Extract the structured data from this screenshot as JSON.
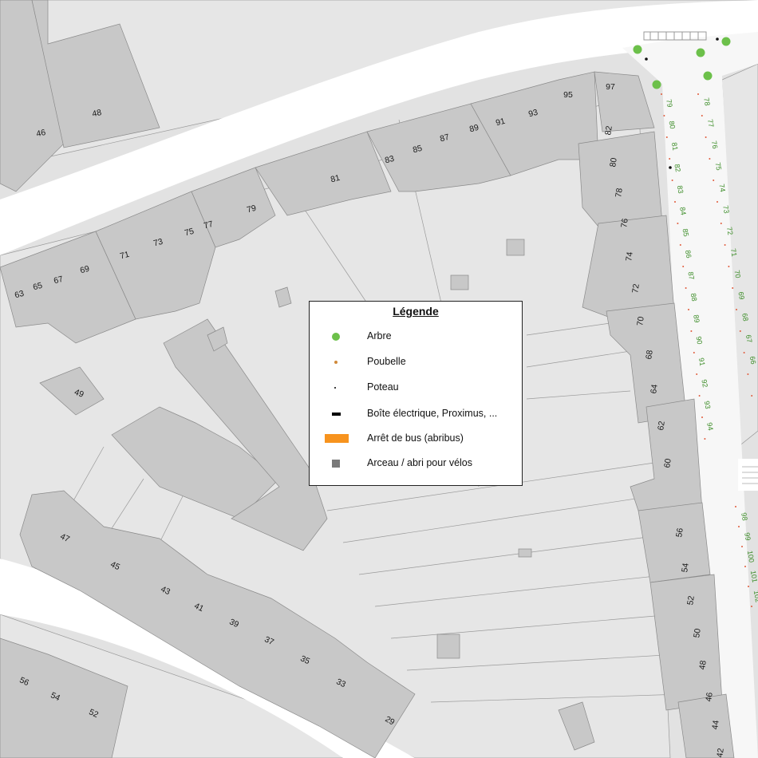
{
  "colors": {
    "background": "#e0e0e0",
    "road": "#ffffff",
    "parcel": "#e6e6e6",
    "building": "#c8c8c8",
    "tree": "#6cc04a",
    "bin": "#d08a3a",
    "bus_stop": "#f7931e",
    "bike": "#7a7a7a",
    "parking_label": "#3e8e2a"
  },
  "legend": {
    "title": "Légende",
    "items": [
      {
        "key": "tree",
        "label": "Arbre",
        "icon": "green-dot"
      },
      {
        "key": "bin",
        "label": "Poubelle",
        "icon": "orange-dot"
      },
      {
        "key": "pole",
        "label": "Poteau",
        "icon": "black-dot"
      },
      {
        "key": "box",
        "label": "Boîte électrique, Proximus, ...",
        "icon": "black-bar"
      },
      {
        "key": "bus",
        "label": "Arrêt de bus (abribus)",
        "icon": "orange-rectangle"
      },
      {
        "key": "bike",
        "label": "Arceau / abri pour vélos",
        "icon": "grey-square"
      }
    ]
  },
  "house_numbers": {
    "upper_street": [
      "46",
      "48",
      "63",
      "65",
      "67",
      "69",
      "71",
      "73",
      "75",
      "77",
      "79",
      "81",
      "83",
      "85",
      "87",
      "89",
      "91",
      "93",
      "95",
      "97"
    ],
    "inner_block": [
      "49"
    ],
    "east_street": [
      "82",
      "80",
      "78",
      "76",
      "74",
      "72",
      "70",
      "68",
      "64",
      "62",
      "60",
      "56",
      "54",
      "52",
      "50",
      "48",
      "46",
      "44",
      "42"
    ],
    "lower_street": [
      "47",
      "45",
      "43",
      "41",
      "39",
      "37",
      "35",
      "33",
      "29",
      "56",
      "54",
      "52"
    ]
  },
  "parking_numbers": {
    "west_column": [
      "79",
      "80",
      "81",
      "82",
      "83",
      "84",
      "85",
      "86",
      "87",
      "88",
      "89",
      "90",
      "91",
      "92",
      "93",
      "94"
    ],
    "east_column": [
      "78",
      "77",
      "76",
      "75",
      "74",
      "73",
      "72",
      "71",
      "70",
      "69",
      "68",
      "67",
      "66"
    ],
    "south_column": [
      "98",
      "99",
      "100",
      "101",
      "102"
    ]
  }
}
